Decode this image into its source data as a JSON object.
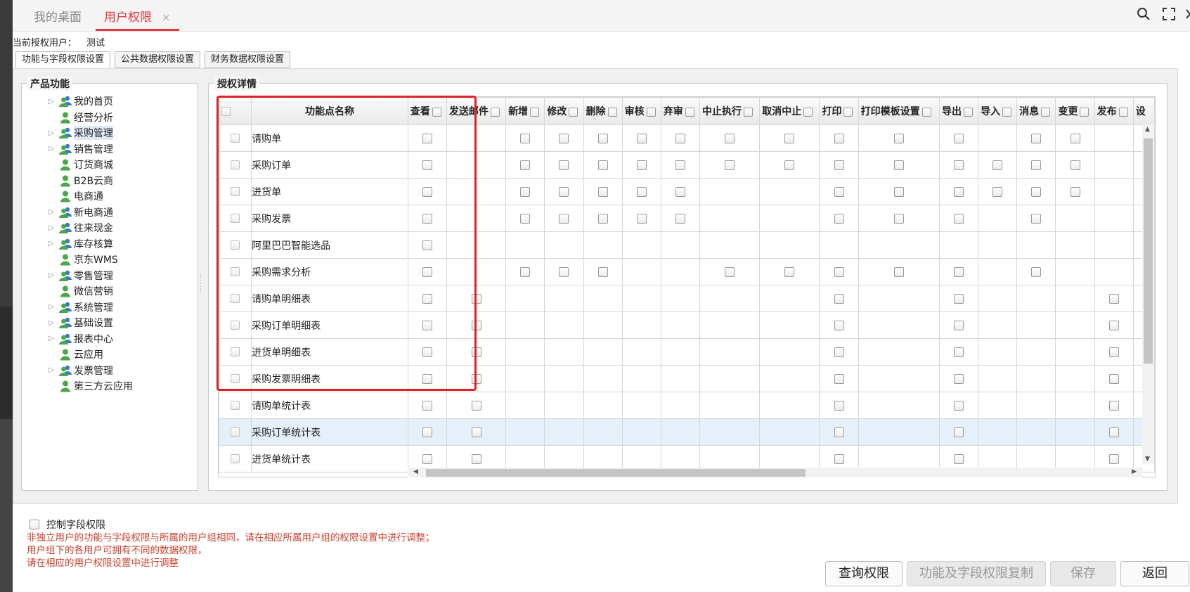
{
  "topbar": {
    "tabs": [
      {
        "label": "我的桌面"
      },
      {
        "label": "用户权限",
        "active": true
      }
    ],
    "close_glyph": "×",
    "icons": [
      "search-icon",
      "fullscreen-icon",
      "close-icon"
    ]
  },
  "user": {
    "label": "当前授权用户：",
    "value": "测试"
  },
  "subtabs": [
    "功能与字段权限设置",
    "公共数据权限设置",
    "财务数据权限设置"
  ],
  "left_panel": {
    "legend": "产品功能",
    "items": [
      {
        "label": "我的首页",
        "expandable": true,
        "icon": "group-icon"
      },
      {
        "label": "经营分析",
        "expandable": false,
        "icon": "user-icon"
      },
      {
        "label": "采购管理",
        "expandable": true,
        "icon": "group-icon",
        "selected": true
      },
      {
        "label": "销售管理",
        "expandable": true,
        "icon": "group-icon"
      },
      {
        "label": "订货商城",
        "expandable": false,
        "icon": "user-icon"
      },
      {
        "label": "B2B云商",
        "expandable": false,
        "icon": "user-icon"
      },
      {
        "label": "电商通",
        "expandable": false,
        "icon": "user-icon"
      },
      {
        "label": "新电商通",
        "expandable": true,
        "icon": "group-icon"
      },
      {
        "label": "往来现金",
        "expandable": true,
        "icon": "group-icon"
      },
      {
        "label": "库存核算",
        "expandable": true,
        "icon": "group-icon"
      },
      {
        "label": "京东WMS",
        "expandable": false,
        "icon": "user-icon"
      },
      {
        "label": "零售管理",
        "expandable": true,
        "icon": "group-icon"
      },
      {
        "label": "微信营销",
        "expandable": false,
        "icon": "user-icon"
      },
      {
        "label": "系统管理",
        "expandable": true,
        "icon": "group-icon"
      },
      {
        "label": "基础设置",
        "expandable": true,
        "icon": "group-icon"
      },
      {
        "label": "报表中心",
        "expandable": true,
        "icon": "group-icon"
      },
      {
        "label": "云应用",
        "expandable": false,
        "icon": "user-icon"
      },
      {
        "label": "发票管理",
        "expandable": true,
        "icon": "group-icon"
      },
      {
        "label": "第三方云应用",
        "expandable": false,
        "icon": "user-icon"
      }
    ]
  },
  "right_panel": {
    "legend": "授权详情",
    "columns": [
      {
        "label": "功能点名称"
      },
      {
        "label": "查看"
      },
      {
        "label": "发送邮件"
      },
      {
        "label": "新增"
      },
      {
        "label": "修改"
      },
      {
        "label": "删除"
      },
      {
        "label": "审核"
      },
      {
        "label": "弃审"
      },
      {
        "label": "中止执行"
      },
      {
        "label": "取消中止"
      },
      {
        "label": "打印"
      },
      {
        "label": "打印模板设置"
      },
      {
        "label": "导出"
      },
      {
        "label": "导入"
      },
      {
        "label": "消息"
      },
      {
        "label": "变更"
      },
      {
        "label": "发布"
      },
      {
        "label": "设"
      }
    ],
    "rows": [
      {
        "name": "请购单",
        "flags": [
          1,
          0,
          1,
          1,
          1,
          1,
          1,
          1,
          1,
          1,
          1,
          1,
          0,
          1,
          1,
          0,
          0
        ]
      },
      {
        "name": "采购订单",
        "flags": [
          1,
          0,
          1,
          1,
          1,
          1,
          1,
          1,
          1,
          1,
          1,
          1,
          1,
          1,
          1,
          0,
          0
        ]
      },
      {
        "name": "进货单",
        "flags": [
          1,
          0,
          1,
          1,
          1,
          1,
          1,
          0,
          0,
          1,
          1,
          1,
          1,
          1,
          1,
          0,
          0
        ]
      },
      {
        "name": "采购发票",
        "flags": [
          1,
          0,
          1,
          1,
          1,
          1,
          1,
          0,
          0,
          1,
          1,
          1,
          0,
          1,
          0,
          0,
          0
        ]
      },
      {
        "name": "阿里巴巴智能选品",
        "flags": [
          1,
          0,
          0,
          0,
          0,
          0,
          0,
          0,
          0,
          0,
          0,
          0,
          0,
          0,
          0,
          0,
          0
        ]
      },
      {
        "name": "采购需求分析",
        "flags": [
          1,
          0,
          1,
          1,
          1,
          0,
          0,
          1,
          1,
          1,
          1,
          1,
          0,
          1,
          0,
          0,
          0
        ]
      },
      {
        "name": "请购单明细表",
        "flags": [
          1,
          1,
          0,
          0,
          0,
          0,
          0,
          0,
          0,
          1,
          0,
          1,
          0,
          0,
          0,
          1,
          0
        ]
      },
      {
        "name": "采购订单明细表",
        "flags": [
          1,
          1,
          0,
          0,
          0,
          0,
          0,
          0,
          0,
          1,
          0,
          1,
          0,
          0,
          0,
          1,
          0
        ]
      },
      {
        "name": "进货单明细表",
        "flags": [
          1,
          1,
          0,
          0,
          0,
          0,
          0,
          0,
          0,
          1,
          0,
          1,
          0,
          0,
          0,
          1,
          0
        ]
      },
      {
        "name": "采购发票明细表",
        "flags": [
          1,
          1,
          0,
          0,
          0,
          0,
          0,
          0,
          0,
          1,
          0,
          1,
          0,
          0,
          0,
          1,
          0
        ]
      },
      {
        "name": "请购单统计表",
        "flags": [
          1,
          1,
          0,
          0,
          0,
          0,
          0,
          0,
          0,
          1,
          0,
          1,
          0,
          0,
          0,
          1,
          0
        ]
      },
      {
        "name": "采购订单统计表",
        "flags": [
          1,
          1,
          0,
          0,
          0,
          0,
          0,
          0,
          0,
          1,
          0,
          1,
          0,
          0,
          0,
          1,
          0
        ],
        "highlighted": true
      },
      {
        "name": "进货单统计表",
        "flags": [
          1,
          1,
          0,
          0,
          0,
          0,
          0,
          0,
          0,
          1,
          0,
          1,
          0,
          0,
          0,
          1,
          0
        ]
      }
    ]
  },
  "field_control": {
    "label": "控制字段权限"
  },
  "notes": [
    "非独立用户的功能与字段权限与所属的用户组相同，请在相应所属用户组的权限设置中进行调整；",
    "用户组下的各用户可拥有不同的数据权限，",
    "请在相应的用户权限设置中进行调整"
  ],
  "buttons": {
    "query": "查询权限",
    "copy": "功能及字段权限复制",
    "save": "保存",
    "back": "返回"
  },
  "colors": {
    "accent": "#e2383d",
    "note_text": "#c8402e",
    "highlight_row": "#e6f0fb"
  }
}
